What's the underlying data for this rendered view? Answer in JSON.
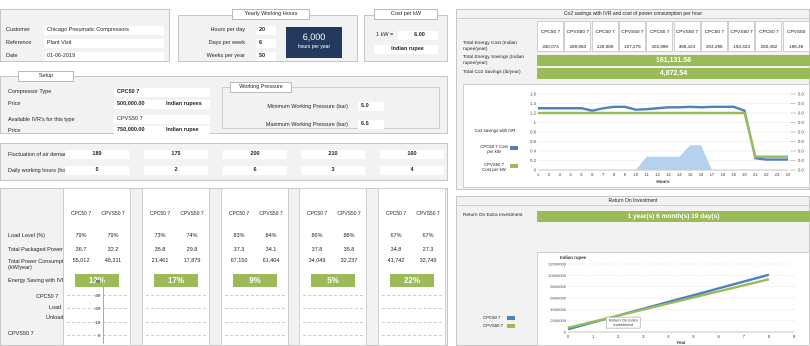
{
  "customer": {
    "customer_label": "Customer",
    "customer_value": "Chicago Pneumatic Compressors",
    "reference_label": "Reference",
    "reference_value": "Plant Visit",
    "date_label": "Date",
    "date_value": "01-06-2019"
  },
  "yearly_hours": {
    "title": "Yearly Working Hours",
    "hours_per_day_label": "Hours per day",
    "hours_per_day": "20",
    "days_per_week_label": "Days per week",
    "days_per_week": "6",
    "weeks_per_year_label": "Weeks per year",
    "weeks_per_year": "50",
    "total": "6,000",
    "total_unit": "hours per year"
  },
  "cost_per_kw": {
    "title": "Cost per kW",
    "kw_label": "1 kW =",
    "kw_value": "6.00",
    "currency": "Indian rupee"
  },
  "setup": {
    "title": "Setup",
    "compressor_type_label": "Compressor Type",
    "compressor_type": "CPC50 7",
    "price_label": "Price",
    "price": "500,000.00",
    "price_currency": "Indian rupees",
    "vr_label": "Available IVR's for this type",
    "vr_type": "CPVS50 7",
    "vr_price_label": "Price",
    "vr_price": "750,000.00",
    "vr_price_currency": "Indian rupee"
  },
  "working_pressure": {
    "title": "Working Pressure",
    "min_label": "Minimum Working Pressure (bar)",
    "min_value": "5.0",
    "max_label": "Maximum Working Pressure (bar)",
    "max_value": "6.5"
  },
  "demand": {
    "fluct_label": "Fluctuation of air demand (cfm)",
    "fluct_values": [
      "189",
      "175",
      "200",
      "210",
      "160"
    ],
    "daily_label": "Daily working hours (hours)",
    "daily_values": [
      "5",
      "2",
      "6",
      "3",
      "4"
    ]
  },
  "comparison": {
    "col_a": "CPC50 7",
    "col_b": "CPVS50 7",
    "load_label": "Load Level (%)",
    "power_label": "Total Packaged Power (kW)",
    "consumption_label": "Total Power Consumption (kW/year)",
    "saving_label": "Energy Saving with IVR (%)",
    "groups": [
      {
        "load": [
          "79%",
          "79%"
        ],
        "power": [
          "36.7",
          "32.2"
        ],
        "consumption": [
          "55,012",
          "48,311"
        ],
        "saving": "12%"
      },
      {
        "load": [
          "73%",
          "74%"
        ],
        "power": [
          "35.8",
          "29.8"
        ],
        "consumption": [
          "21,461",
          "17,879"
        ],
        "saving": "17%"
      },
      {
        "load": [
          "83%",
          "84%"
        ],
        "power": [
          "37.3",
          "34.1"
        ],
        "consumption": [
          "67,150",
          "61,404"
        ],
        "saving": "9%"
      },
      {
        "load": [
          "86%",
          "88%"
        ],
        "power": [
          "37.8",
          "35.8"
        ],
        "consumption": [
          "34,049",
          "32,237"
        ],
        "saving": "5%"
      },
      {
        "load": [
          "67%",
          "67%"
        ],
        "power": [
          "34.8",
          "27.3"
        ],
        "consumption": [
          "41,742",
          "32,749"
        ],
        "saving": "22%"
      }
    ],
    "legend_a": "CPC50 7",
    "legend_load": "Load",
    "legend_unload": "Unload",
    "legend_b": "CPVS50 7",
    "load_ticks": [
      "40",
      "30",
      "20",
      "10",
      "0"
    ]
  },
  "co2": {
    "title": "Co2 savings with IVR and cost of power consumption per hour",
    "headers": [
      "CPC50 7",
      "CPVS50 7",
      "CPC50 7",
      "CPVS50 7",
      "CPC50 7",
      "CPVS50 7",
      "CPC50 7",
      "CPVS50 7",
      "CPC50 7",
      "CPVS50"
    ],
    "energy_cost_label": "Total Energy Cost (Indian rupee/year)",
    "energy_costs": [
      "330,074",
      "289,863",
      "128,889",
      "107,275",
      "402,899",
      "368,424",
      "204,296",
      "193,423",
      "250,452",
      "196,49"
    ],
    "savings_label": "Total Energy Savings (Indian rupee/year)",
    "savings_value": "161,131.58",
    "co2_label": "Total Co2 Savings (ib/year)",
    "co2_value": "4,872.54"
  },
  "co2_chart": {
    "legend_title": "Co2 savings with IVR",
    "series_a": "CPC50 7 Cost per kW",
    "series_b": "CPVS50 7 Cost per kW",
    "xlabel": "Hours",
    "colors": {
      "a": "#4f81bd",
      "b": "#9bbb59"
    },
    "chart_data": {
      "type": "line",
      "xlabel": "Hours",
      "x": [
        1,
        2,
        3,
        4,
        5,
        6,
        7,
        8,
        9,
        10,
        11,
        12,
        13,
        14,
        15,
        16,
        17,
        18,
        19,
        20,
        21,
        22,
        23,
        24
      ],
      "x_ticks": [
        "1",
        "2",
        "3",
        "4",
        "5",
        "6",
        "7",
        "8",
        "9",
        "10",
        "11",
        "12",
        "13",
        "14",
        "15",
        "16",
        "17",
        "18",
        "19",
        "20",
        "21",
        "22",
        "23",
        "24"
      ],
      "y_left_ticks": [
        "1.6",
        "1.4",
        "1.2",
        "1",
        "0.8",
        "0.6",
        "0.4",
        "0.2",
        "0"
      ],
      "y_right_ticks": [
        "0.0",
        "0.0",
        "0.0",
        "0.0",
        "0.0",
        "0.0",
        "0.0",
        "0.0",
        "0.0"
      ],
      "ylim": [
        0,
        1.6
      ],
      "series": [
        {
          "name": "CPC50 7 Cost per kW",
          "values": [
            1.3,
            1.3,
            1.3,
            1.3,
            1.3,
            1.25,
            1.3,
            1.33,
            1.33,
            1.27,
            1.28,
            1.3,
            1.32,
            1.32,
            1.33,
            1.32,
            1.33,
            1.33,
            1.33,
            1.25,
            0.25,
            0.22,
            0.22,
            0.22
          ]
        },
        {
          "name": "CPVS50 7 Cost per kW",
          "values": [
            1.2,
            1.2,
            1.2,
            1.2,
            1.2,
            1.2,
            1.2,
            1.2,
            1.2,
            1.2,
            1.2,
            1.2,
            1.2,
            1.2,
            1.2,
            1.2,
            1.2,
            1.2,
            1.2,
            1.2,
            0.28,
            0.28,
            0.28,
            0.28
          ]
        },
        {
          "name": "",
          "type": "area",
          "values": [
            0,
            0,
            0,
            0,
            0,
            0,
            0,
            0,
            0,
            0,
            0.28,
            0.28,
            0.28,
            0.28,
            0.52,
            0.52,
            0,
            0,
            0,
            0,
            0,
            0,
            0,
            0
          ]
        }
      ]
    }
  },
  "roi": {
    "title": "Return On Investment",
    "label": "Return On Extra Investment",
    "value": "1 year(s)   6 month(s)   19 day(s)",
    "chart": {
      "ylabel": "Indian rupee",
      "xlabel": "Year",
      "series_a": "CPC50 7",
      "series_b": "CPVS50 7",
      "annotation": "Return On Extra Investment",
      "colors": {
        "a": "#4f81bd",
        "b": "#9bbb59"
      },
      "chart_data": {
        "type": "line",
        "x": [
          0,
          1,
          2,
          3,
          4,
          5,
          6,
          7,
          8,
          9
        ],
        "x_ticks": [
          "0",
          "1",
          "2",
          "3",
          "4",
          "5",
          "6",
          "7",
          "8",
          "9"
        ],
        "y_ticks": [
          "12000000",
          "10000000",
          "8000000",
          "6000000",
          "4000000",
          "2000000",
          "0"
        ],
        "ylim": [
          0,
          12000000
        ],
        "xlim": [
          0,
          9
        ],
        "series": [
          {
            "name": "CPC50 7",
            "values": [
              500000,
              1700000,
              2900000,
              4100000,
              5300000,
              6500000,
              7700000,
              8900000,
              10100000
            ]
          },
          {
            "name": "CPVS50 7",
            "values": [
              750000,
              1820000,
              2890000,
              3960000,
              5030000,
              6100000,
              7170000,
              8240000,
              9300000
            ]
          }
        ]
      }
    }
  }
}
